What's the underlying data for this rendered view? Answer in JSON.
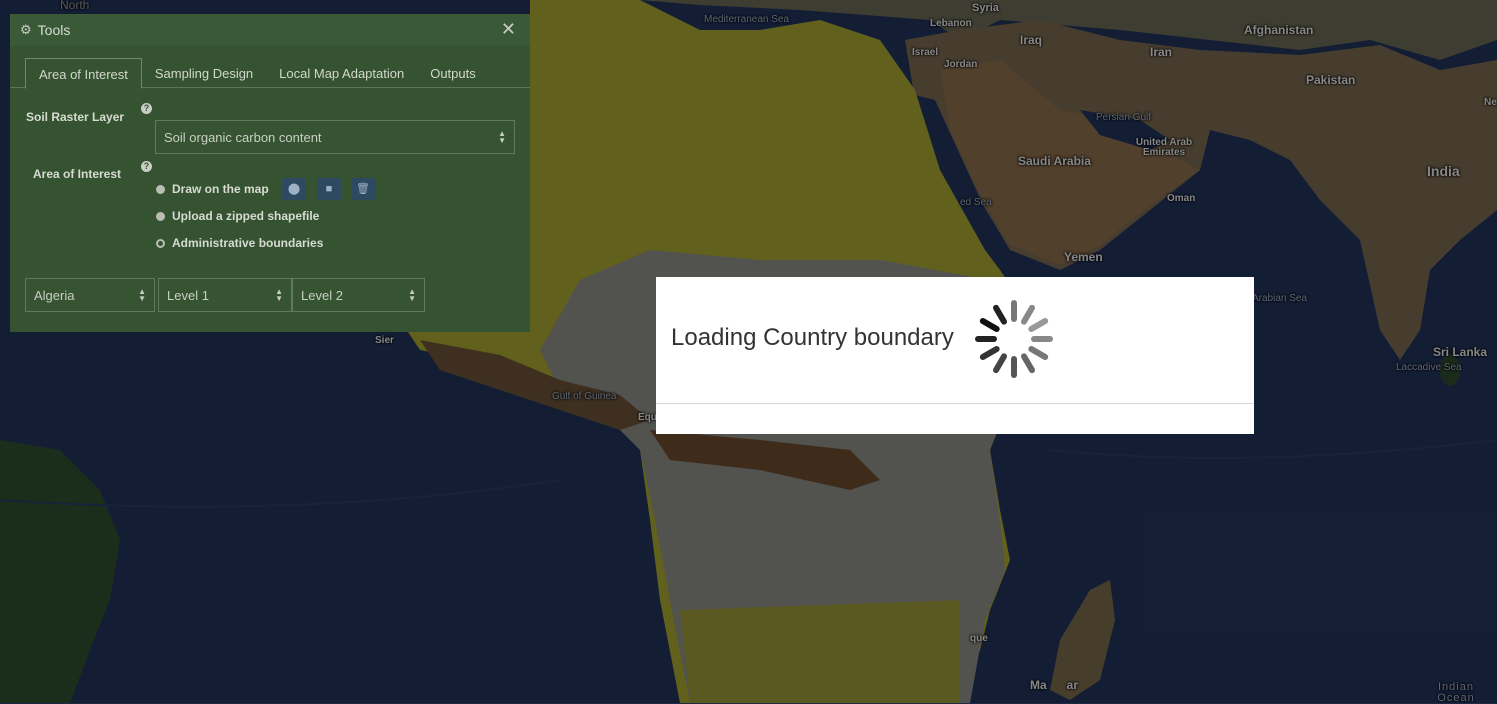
{
  "map": {
    "labels": {
      "north": "North",
      "mediterranean": "Mediterranean Sea",
      "syria": "Syria",
      "lebanon": "Lebanon",
      "israel": "Israel",
      "jordan": "Jordan",
      "iraq": "Iraq",
      "iran": "Iran",
      "afghanistan": "Afghanistan",
      "pakistan": "Pakistan",
      "ne": "Ne",
      "persian_gulf": "Persian Gulf",
      "uae": "United Arab Emirates",
      "saudi": "Saudi Arabia",
      "red_sea": "ed Sea",
      "oman": "Oman",
      "india": "India",
      "yemen": "Yemen",
      "arabian_sea": "Arabian Sea",
      "sri_lanka": "Sri Lanka",
      "laccadive": "Laccadive Sea",
      "sierra": "Sier",
      "gulf_guinea": "Gulf of Guinea",
      "equ": "Equ",
      "que": "que",
      "madagascar": "Ma      ar",
      "indian_ocean": "Indian Ocean"
    }
  },
  "tools": {
    "title": "Tools",
    "close_icon": "close-icon",
    "gear_icon": "gear-icon",
    "tabs": [
      "Area of Interest",
      "Sampling Design",
      "Local Map Adaptation",
      "Outputs"
    ],
    "soil_raster_label": "Soil Raster Layer",
    "soil_raster_value": "Soil organic carbon content",
    "aoi_label": "Area of Interest",
    "options": {
      "draw": "Draw on the map",
      "upload": "Upload a zipped shapefile",
      "admin": "Administrative boundaries"
    },
    "selected_option": "Administrative boundaries",
    "draw_tools": [
      "map-marker-icon",
      "rectangle-icon",
      "trash-icon"
    ],
    "country": "Algeria",
    "level1": "Level 1",
    "level2": "Level 2"
  },
  "modal": {
    "message": "Loading Country boundary"
  }
}
